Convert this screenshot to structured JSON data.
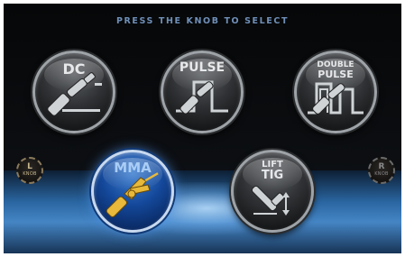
{
  "header": {
    "title": "PRESS THE KNOB TO SELECT"
  },
  "modes": [
    {
      "label": "DC",
      "icon": "torch-icon",
      "selected": false
    },
    {
      "label": "PULSE",
      "icon": "pulse-wave-icon",
      "selected": false
    },
    {
      "label_line1": "DOUBLE",
      "label_line2": "PULSE",
      "icon": "double-pulse-wave-icon",
      "selected": false
    },
    {
      "label": "MMA",
      "icon": "electrode-holder-icon",
      "selected": true
    },
    {
      "label_line1": "LIFT",
      "label_line2": "TIG",
      "icon": "tig-torch-icon",
      "selected": false
    }
  ],
  "knobs": {
    "left": {
      "letter": "L",
      "word": "KNOB"
    },
    "right": {
      "letter": "R",
      "word": "KNOB"
    }
  },
  "colors": {
    "selected_accent": "#1a56b4",
    "floor": "#4b92d8",
    "title": "#6f8fb8"
  }
}
